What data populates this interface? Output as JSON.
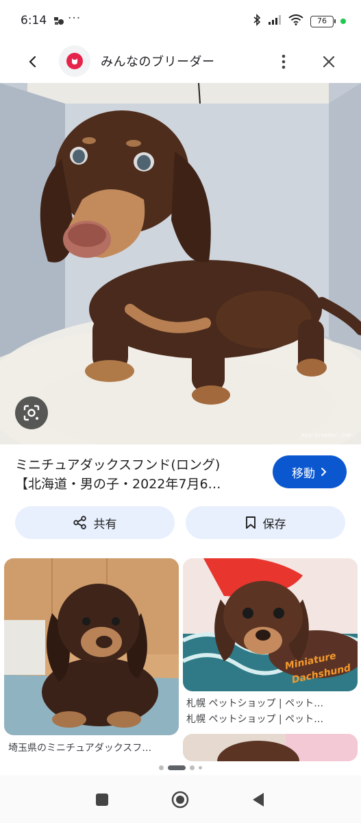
{
  "status_bar": {
    "time": "6:14",
    "more": "···",
    "battery": "76"
  },
  "header": {
    "site_name": "みんなのブリーダー"
  },
  "main_image": {
    "watermark": "min-breeder.com"
  },
  "result": {
    "title_line1": "ミニチュアダックスフンド(ロング)",
    "title_line2": "【北海道・男の子・2022年7月6…",
    "visit_label": "移動"
  },
  "actions": {
    "share_label": "共有",
    "save_label": "保存"
  },
  "related": [
    {
      "caption": "埼玉県のミニチュアダックスフ…"
    },
    {
      "caption": "札幌 ペットショップ | ペット…",
      "caption2": "札幌 ペットショップ | ペット…",
      "overlay_line1": "Miniature",
      "overlay_line2": "Dachshund"
    }
  ],
  "colors": {
    "accent": "#0b57d0",
    "chip_bg": "#e8f0fe",
    "logo_red": "#e5234b"
  }
}
